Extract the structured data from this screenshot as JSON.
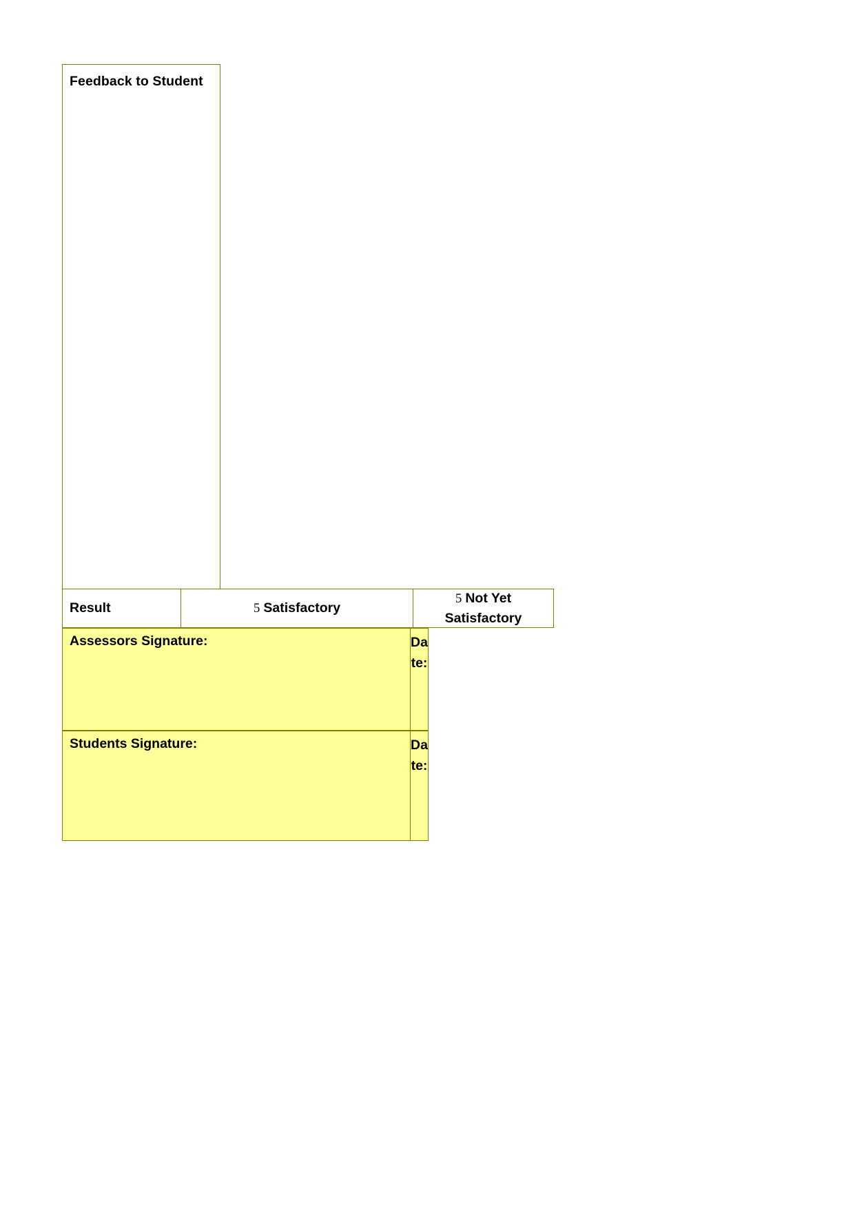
{
  "document": {
    "type": "assessment-feedback-form",
    "border_color": "#808000",
    "highlight_color": "#ffff99",
    "page_background": "#ffffff"
  },
  "feedback": {
    "label": "Feedback to Student",
    "value": ""
  },
  "result": {
    "label": "Result",
    "options": [
      {
        "symbol": "5",
        "label": "Satisfactory"
      },
      {
        "symbol": "5",
        "label": "Not Yet Satisfactory"
      }
    ]
  },
  "signatures": [
    {
      "label": "Assessors Signature:",
      "date_label": "Date:",
      "value": "",
      "date_value": ""
    },
    {
      "label": "Students Signature:",
      "date_label": "Date:",
      "value": "",
      "date_value": ""
    }
  ]
}
